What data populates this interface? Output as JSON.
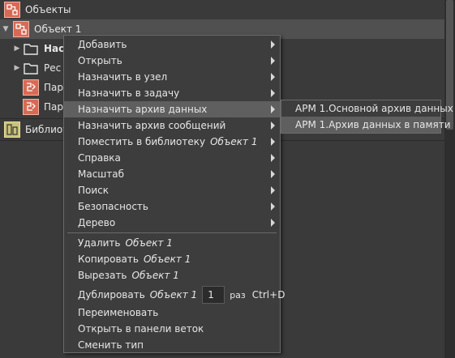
{
  "tree": {
    "header_label": "Объекты",
    "items": [
      {
        "label": "Объект 1"
      },
      {
        "label": "Нас"
      },
      {
        "label": "Рес"
      },
      {
        "label": "Пар"
      },
      {
        "label": "Пар"
      },
      {
        "label": "Библиот"
      }
    ]
  },
  "menu": {
    "items": [
      {
        "label": "Добавить"
      },
      {
        "label": "Открыть"
      },
      {
        "label": "Назначить в узел"
      },
      {
        "label": "Назначить в задачу"
      },
      {
        "label": "Назначить архив данных"
      },
      {
        "label": "Назначить архив сообщений"
      },
      {
        "label": "Поместить в библиотеку",
        "object": "Объект 1"
      },
      {
        "label": "Справка"
      },
      {
        "label": "Масштаб"
      },
      {
        "label": "Поиск"
      },
      {
        "label": "Безопасность"
      },
      {
        "label": "Дерево"
      }
    ],
    "actions": [
      {
        "label": "Удалить",
        "object": "Объект 1"
      },
      {
        "label": "Копировать",
        "object": "Объект 1"
      },
      {
        "label": "Вырезать",
        "object": "Объект 1"
      }
    ],
    "duplicate": {
      "label": "Дублировать",
      "object": "Объект 1",
      "count": "1",
      "unit": "раз",
      "shortcut": "Ctrl+D"
    },
    "tail": [
      {
        "label": "Переименовать"
      },
      {
        "label": "Открыть в панели веток"
      },
      {
        "label": "Сменить тип"
      }
    ]
  },
  "submenu": {
    "items": [
      {
        "label": "АРМ 1.Основной архив данных"
      },
      {
        "label": "АРМ 1.Архив данных в памяти"
      }
    ]
  },
  "colors": {
    "object_icon": "#d86a55",
    "library_icon": "#c9c27b",
    "highlight": "#5f5f5f"
  }
}
